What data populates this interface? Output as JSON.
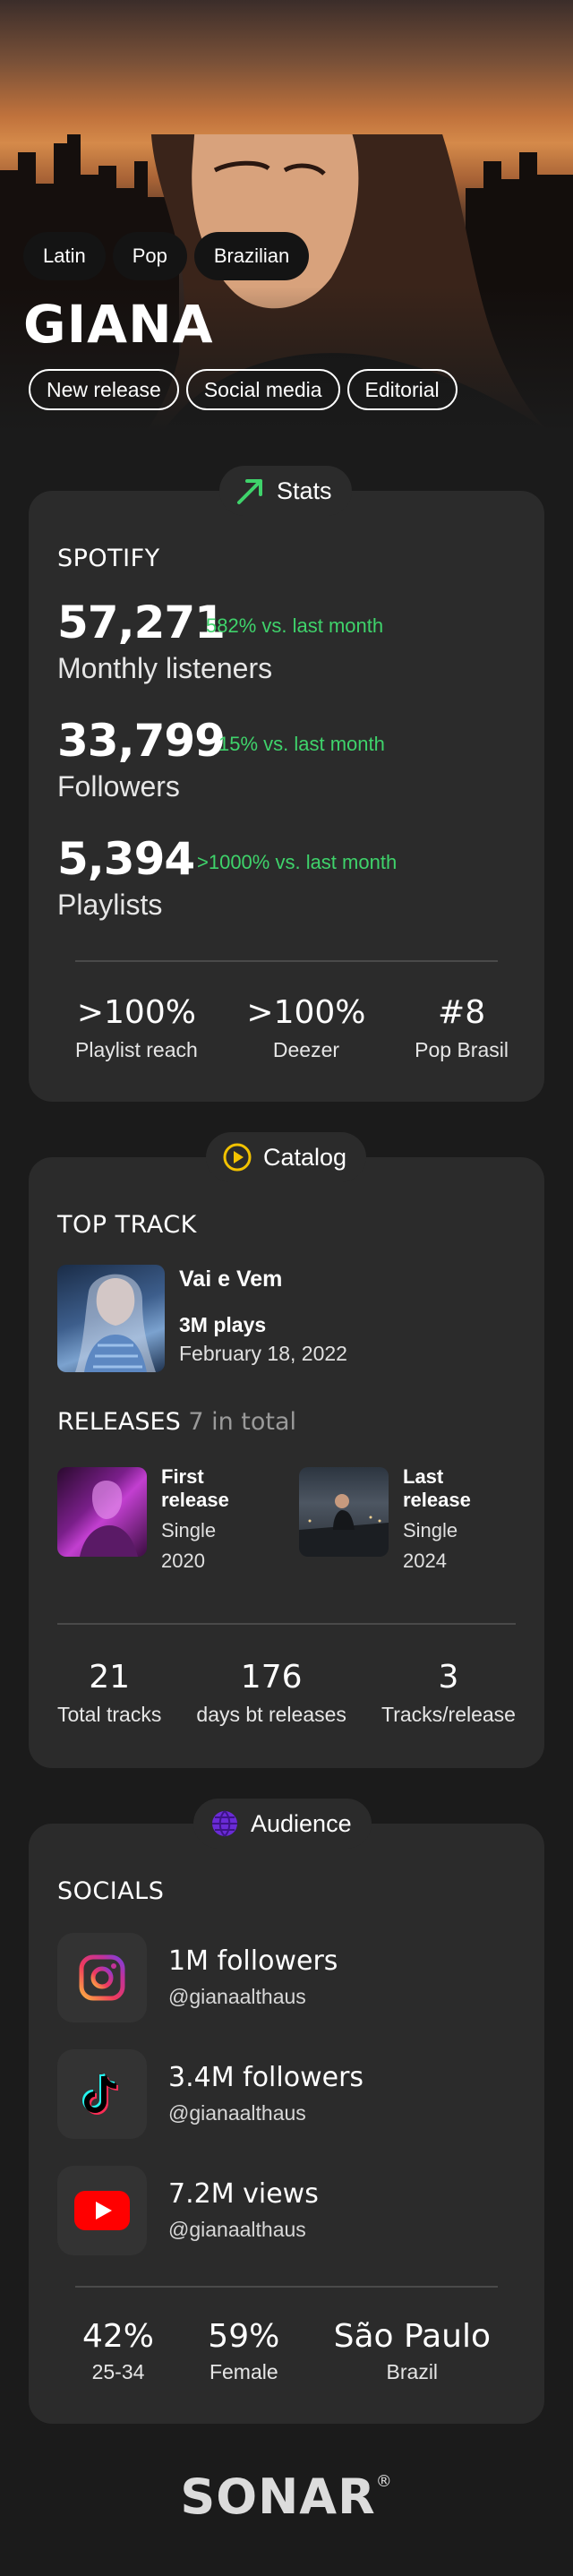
{
  "hero": {
    "genres": [
      "Latin",
      "Pop",
      "Brazilian"
    ],
    "artist_name": "GIANA",
    "tags": [
      "New release",
      "Social media",
      "Editorial"
    ]
  },
  "stats_section": {
    "pill_label": "Stats",
    "platform_label": "SPOTIFY",
    "metrics": [
      {
        "value": "57,271",
        "change": "582% vs. last month",
        "label": "Monthly listeners"
      },
      {
        "value": "33,799",
        "change": "15% vs. last month",
        "label": "Followers"
      },
      {
        "value": "5,394",
        "change": ">1000% vs. last month",
        "label": "Playlists"
      }
    ],
    "summary": [
      {
        "value": ">100%",
        "label": "Playlist reach"
      },
      {
        "value": ">100%",
        "label": "Deezer"
      },
      {
        "value": "#8",
        "label": "Pop Brasil"
      }
    ]
  },
  "catalog_section": {
    "pill_label": "Catalog",
    "top_track_label": "TOP TRACK",
    "top_track": {
      "title": "Vai e Vem",
      "plays": "3M plays",
      "date": "February 18, 2022"
    },
    "releases_label": "RELEASES",
    "releases_count": "7 in total",
    "first_release": {
      "title_line1": "First",
      "title_line2": "release",
      "type": "Single",
      "year": "2020"
    },
    "last_release": {
      "title_line1": "Last",
      "title_line2": "release",
      "type": "Single",
      "year": "2024"
    },
    "summary": [
      {
        "value": "21",
        "label": "Total tracks"
      },
      {
        "value": "176",
        "label": "days bt releases"
      },
      {
        "value": "3",
        "label": "Tracks/release"
      }
    ]
  },
  "audience_section": {
    "pill_label": "Audience",
    "socials_label": "SOCIALS",
    "socials": [
      {
        "icon": "instagram-icon",
        "metric": "1M followers",
        "handle": "@gianaalthaus"
      },
      {
        "icon": "tiktok-icon",
        "metric": "3.4M followers",
        "handle": "@gianaalthaus"
      },
      {
        "icon": "youtube-icon",
        "metric": "7.2M views",
        "handle": "@gianaalthaus"
      }
    ],
    "demographics": [
      {
        "value": "42%",
        "label": "25-34"
      },
      {
        "value": "59%",
        "label": "Female"
      },
      {
        "value": "São Paulo",
        "label": "Brazil"
      }
    ]
  },
  "footer": {
    "logo": "SONAR",
    "mark": "®"
  },
  "colors": {
    "positive": "#3fd36b",
    "card": "#2b2b2b",
    "background": "#1b1b1b",
    "catalog_icon": "#f2c200",
    "audience_icon": "#6a2bd6"
  }
}
